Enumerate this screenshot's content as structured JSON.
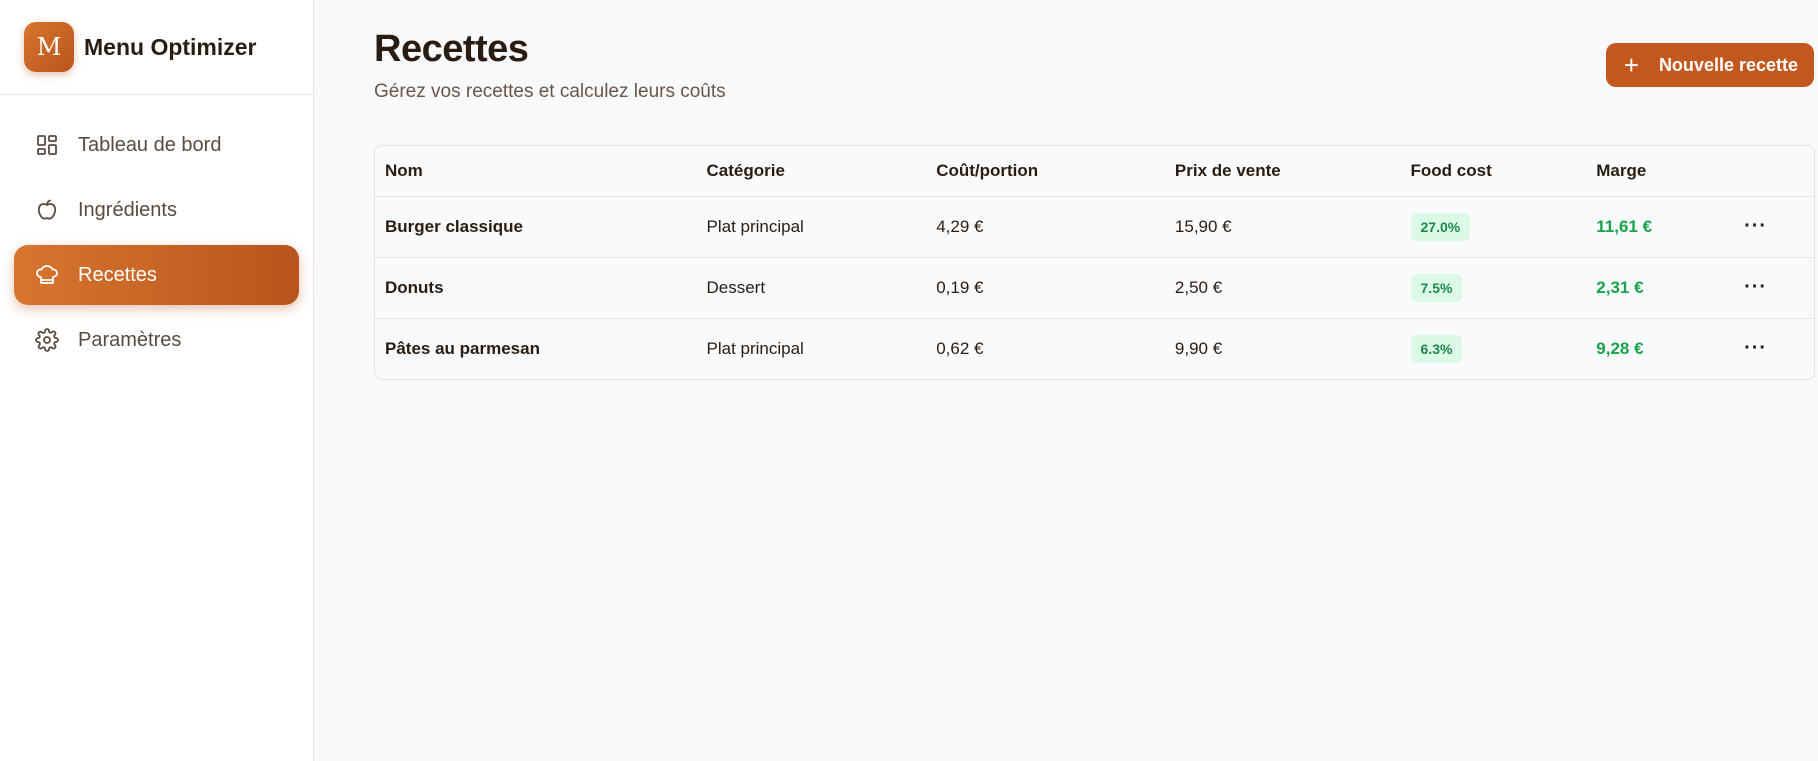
{
  "brand": {
    "logo_letter": "M",
    "name": "Menu Optimizer"
  },
  "nav": [
    {
      "label": "Tableau de bord",
      "icon": "dashboard-icon",
      "active": false
    },
    {
      "label": "Ingrédients",
      "icon": "apple-icon",
      "active": false
    },
    {
      "label": "Recettes",
      "icon": "chef-hat-icon",
      "active": true
    },
    {
      "label": "Paramètres",
      "icon": "gear-icon",
      "active": false
    }
  ],
  "page": {
    "title": "Recettes",
    "subtitle": "Gérez vos recettes et calculez leurs coûts",
    "new_button": "Nouvelle recette"
  },
  "table": {
    "headers": [
      "Nom",
      "Catégorie",
      "Coût/portion",
      "Prix de vente",
      "Food cost",
      "Marge",
      ""
    ],
    "rows": [
      {
        "name": "Burger classique",
        "category": "Plat principal",
        "cost": "4,29 €",
        "price": "15,90 €",
        "food_cost": "27.0%",
        "margin": "11,61 €"
      },
      {
        "name": "Donuts",
        "category": "Dessert",
        "cost": "0,19 €",
        "price": "2,50 €",
        "food_cost": "7.5%",
        "margin": "2,31 €"
      },
      {
        "name": "Pâtes au parmesan",
        "category": "Plat principal",
        "cost": "0,62 €",
        "price": "9,90 €",
        "food_cost": "6.3%",
        "margin": "9,28 €"
      }
    ],
    "more_label": "···"
  },
  "colors": {
    "accent": "#c2581e",
    "margin_green": "#16a34a",
    "badge_bg": "#dcf8e6"
  }
}
